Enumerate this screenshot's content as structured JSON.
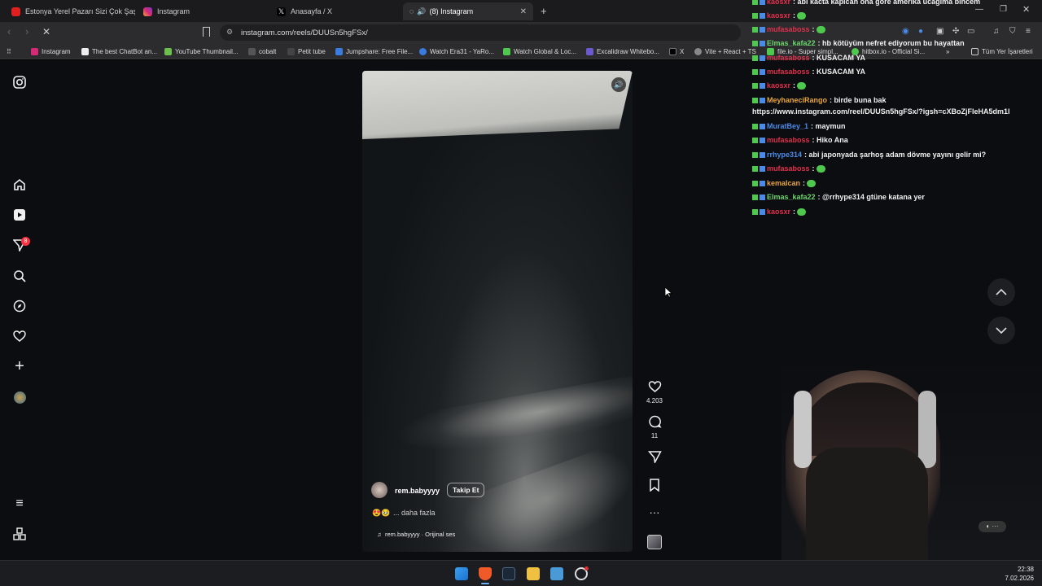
{
  "tabs": [
    {
      "label": "Estonya Yerel Pazarı Sizi Çok Şaşırtacak",
      "active": false
    },
    {
      "label": "Instagram",
      "active": false
    },
    {
      "label": "Anasayfa / X",
      "active": false
    },
    {
      "label": "(8) Instagram",
      "active": true
    }
  ],
  "address": {
    "url": "instagram.com/reels/DUUSn5hgFSx/"
  },
  "bookmarks": [
    "Instagram",
    "The best ChatBot an...",
    "YouTube Thumbnail...",
    "cobalt",
    "Petit tube",
    "Jumpshare: Free File...",
    "Watch Era31 - YaRo...",
    "Watch Global & Loc...",
    "Excalidraw Whitebo...",
    "X",
    "Vite + React + TS",
    "file.io - Super simpl...",
    "hitbox.io - Official Si..."
  ],
  "bookmarks_all": "Tüm Yer İşaretleri",
  "nav": {
    "notification_count": "8"
  },
  "reel": {
    "username": "rem.babyyyy",
    "follow_label": "Takip Et",
    "caption_more": "... daha fazla",
    "audio": "rem.babyyyy · Orijinal ses",
    "likes": "4.203",
    "comments": "11"
  },
  "chat": [
    {
      "user": "kaosxr",
      "color": "#e0304c",
      "text": ": abi kacta kapican ona gore amerika ucagima bincem",
      "emote": false
    },
    {
      "user": "kaosxr",
      "color": "#e0304c",
      "text": ":",
      "emote": true
    },
    {
      "user": "mufasaboss",
      "color": "#e0304c",
      "text": ":",
      "emote": true
    },
    {
      "user": "Elmas_kafa22",
      "color": "#6cd66c",
      "text": ": hb kötüyüm nefret ediyorum bu hayattan",
      "emote": false
    },
    {
      "user": "mufasaboss",
      "color": "#e0304c",
      "text": ": KUSACAM YA",
      "emote": false
    },
    {
      "user": "mufasaboss",
      "color": "#e0304c",
      "text": ": KUSACAM YA",
      "emote": false
    },
    {
      "user": "kaosxr",
      "color": "#e0304c",
      "text": ":",
      "emote": true
    },
    {
      "user": "MeyhaneciRango",
      "color": "#e8a53c",
      "text": ": birde buna bak",
      "emote": false
    },
    {
      "user": "",
      "color": "#f2f2f2",
      "text": "https://www.instagram.com/reel/DUUSn5hgFSx/?igsh=cXBoZjFleHA5dm1l",
      "emote": false
    },
    {
      "user": "MuratBey_1",
      "color": "#4a8be8",
      "text": ": maymun",
      "emote": false
    },
    {
      "user": "mufasaboss",
      "color": "#e0304c",
      "text": ": Hiko Ana",
      "emote": false
    },
    {
      "user": "rrhype314",
      "color": "#4a8be8",
      "text": ": abi japonyada şarhoş adam dövme yayını gelir mi?",
      "emote": false
    },
    {
      "user": "mufasaboss",
      "color": "#e0304c",
      "text": ":",
      "emote": true
    },
    {
      "user": "kemalcan",
      "color": "#e8a53c",
      "text": ":",
      "emote": true
    },
    {
      "user": "Elmas_kafa22",
      "color": "#6cd66c",
      "text": ": @rrhype314 gtüne katana yer",
      "emote": false
    },
    {
      "user": "kaosxr",
      "color": "#e0304c",
      "text": ":",
      "emote": true
    }
  ],
  "clock": {
    "time": "22:38",
    "date": "7.02.2026"
  }
}
